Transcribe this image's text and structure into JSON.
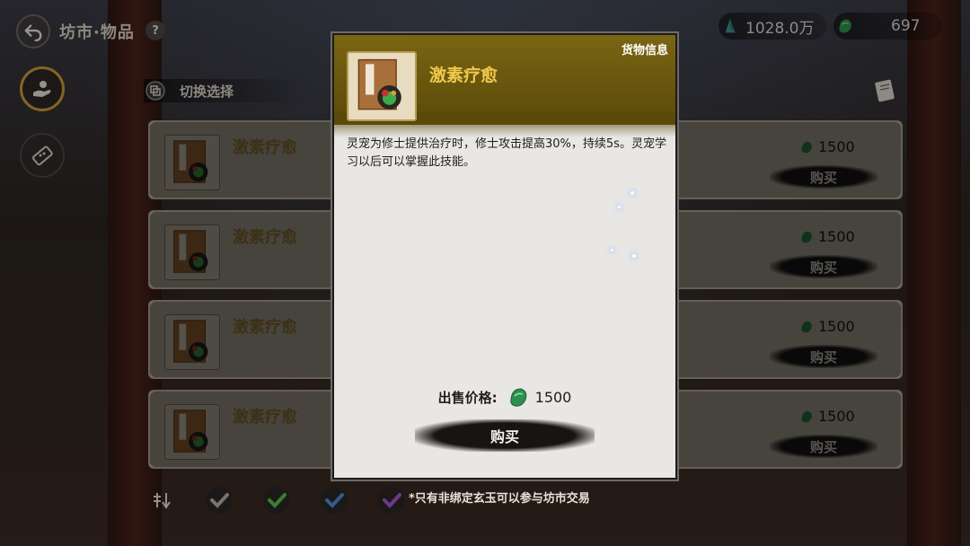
{
  "header": {
    "title": "坊市·物品",
    "help_label": "?"
  },
  "currencies": [
    {
      "icon": "spirit-stone-icon",
      "value": "1028.0万"
    },
    {
      "icon": "jade-icon",
      "value": "697"
    }
  ],
  "switch": {
    "label": "切换选择"
  },
  "items": [
    {
      "name": "激素疗愈",
      "price": "1500",
      "buy_label": "购买"
    },
    {
      "name": "激素疗愈",
      "price": "1500",
      "buy_label": "购买"
    },
    {
      "name": "激素疗愈",
      "price": "1500",
      "buy_label": "购买"
    },
    {
      "name": "激素疗愈",
      "price": "1500",
      "buy_label": "购买"
    }
  ],
  "modal": {
    "tag": "货物信息",
    "name": "激素疗愈",
    "description": "灵宠为修士提供治疗时，修士攻击提高30%，持续5s。灵宠学习以后可以掌握此技能。",
    "price_label": "出售价格:",
    "price_value": "1500",
    "buy_label": "购买"
  },
  "notice": "*只有非绑定玄玉可以参与坊市交易",
  "colors": {
    "accent_gold": "#f0c84c",
    "header_brown": "#7a6512",
    "jade_green": "#2f9a55"
  }
}
